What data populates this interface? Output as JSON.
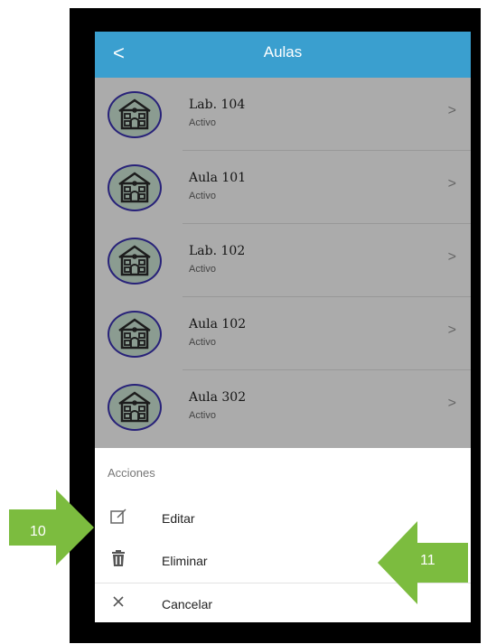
{
  "header": {
    "back_glyph": "<",
    "title": "Aulas"
  },
  "items": [
    {
      "name": "Lab. 104",
      "status": "Activo"
    },
    {
      "name": "Aula 101",
      "status": "Activo"
    },
    {
      "name": "Lab. 102",
      "status": "Activo"
    },
    {
      "name": "Aula 102",
      "status": "Activo"
    },
    {
      "name": "Aula 302",
      "status": "Activo"
    }
  ],
  "chevron": ">",
  "sheet": {
    "title": "Acciones",
    "actions": [
      {
        "label": "Editar",
        "icon": "edit-icon"
      },
      {
        "label": "Eliminar",
        "icon": "trash-icon"
      },
      {
        "label": "Cancelar",
        "icon": "close-icon"
      }
    ]
  },
  "callouts": [
    {
      "label": "10",
      "color": "#7cbc3f"
    },
    {
      "label": "11",
      "color": "#7cbc3f"
    }
  ]
}
